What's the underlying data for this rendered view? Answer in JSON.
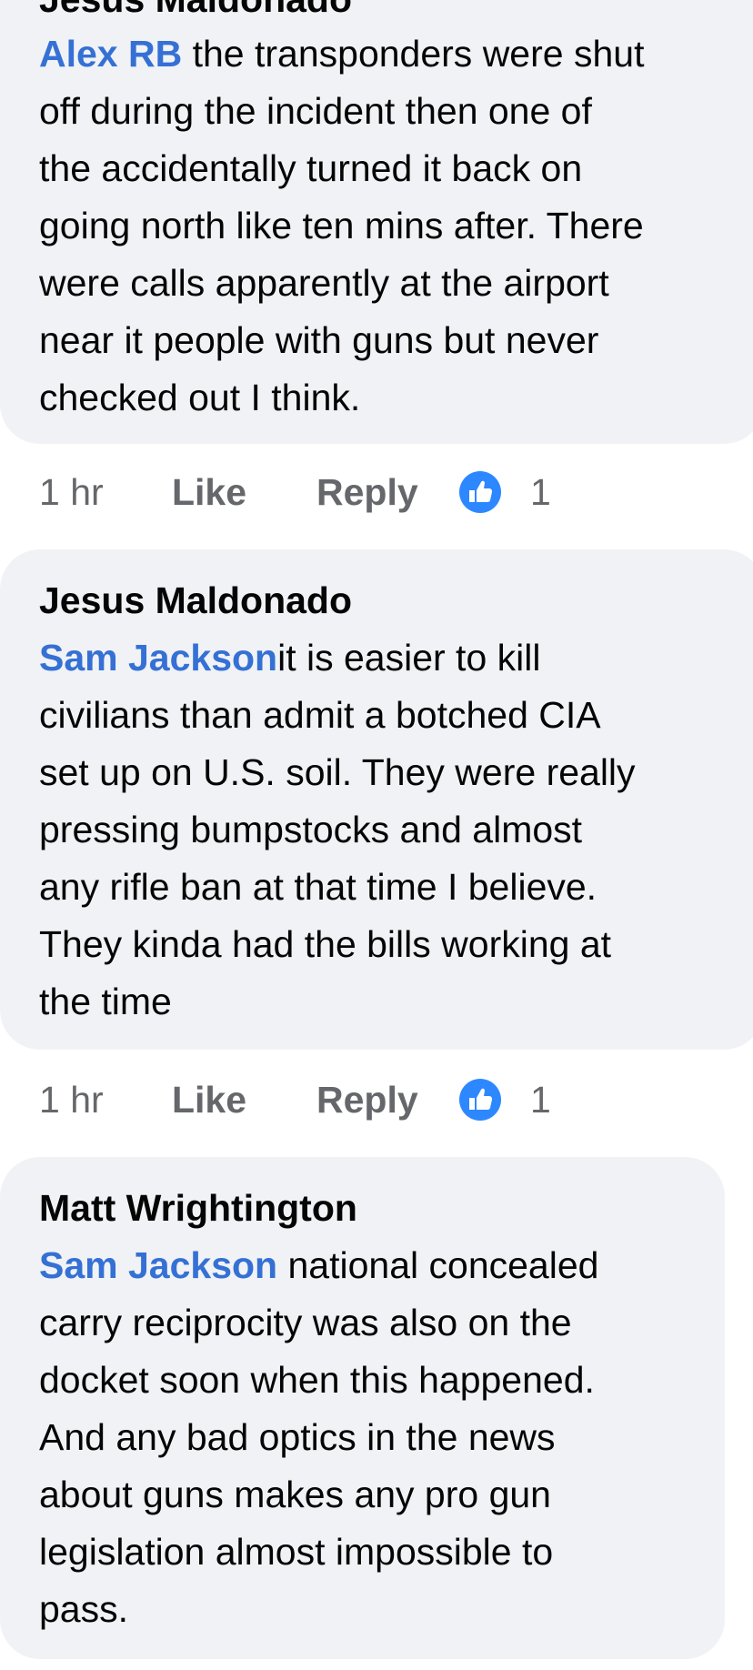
{
  "comments": [
    {
      "author": "Jesus Maldonado",
      "mention": "Alex RB",
      "lines": [
        " the transponders were shut",
        "off during the incident then one of",
        "the accidentally turned it back on",
        "going north like ten mins after. There",
        "were calls apparently at the airport",
        "near it people with guns but never",
        "checked out I think."
      ],
      "time": "1 hr",
      "like_label": "Like",
      "reply_label": "Reply",
      "reaction_icon": "thumbs-up-icon",
      "reaction_count": "1"
    },
    {
      "author": "Jesus Maldonado",
      "mention": "Sam Jackson",
      "lines": [
        "it is easier to kill",
        "civilians than admit a botched CIA",
        "set up on U.S. soil. They were really",
        "pressing bumpstocks and almost",
        "any rifle ban at that time I believe.",
        "They kinda had the bills working at",
        "the time"
      ],
      "time": "1 hr",
      "like_label": "Like",
      "reply_label": "Reply",
      "reaction_icon": "thumbs-up-icon",
      "reaction_count": "1"
    },
    {
      "author": "Matt Wrightington",
      "mention": "Sam Jackson",
      "lines": [
        " national concealed",
        "carry reciprocity was also on the",
        "docket soon when this happened.",
        "And any bad optics in the news",
        "about guns makes any pro gun",
        "legislation almost impossible to",
        "pass."
      ]
    }
  ],
  "colors": {
    "bubble": "#f0f2f5",
    "mention": "#3570d4",
    "meta": "#65676b",
    "reaction": "#2d88ff"
  }
}
